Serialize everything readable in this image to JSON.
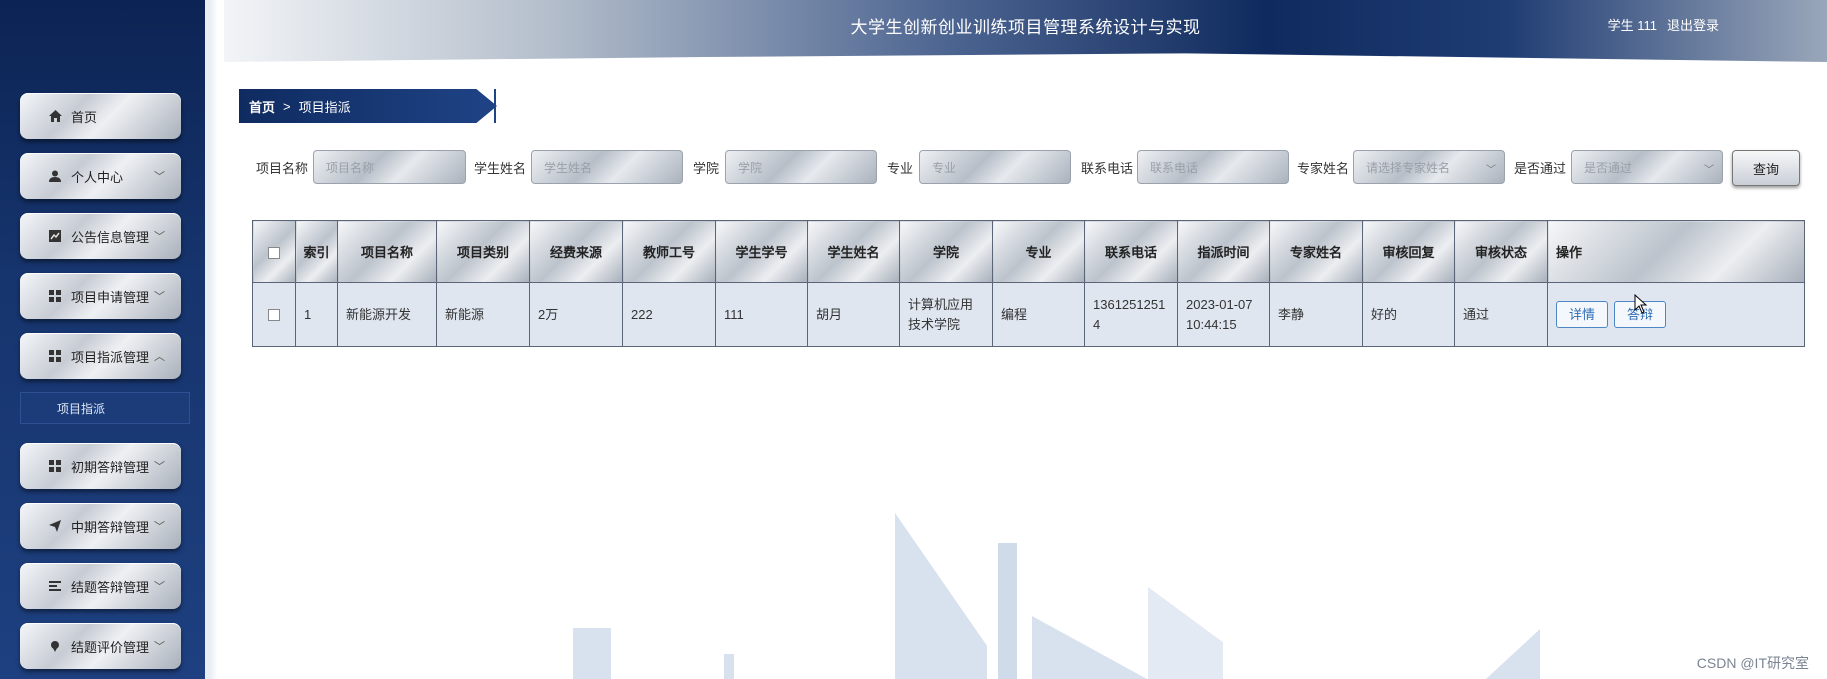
{
  "header": {
    "title": "大学生创新创业训练项目管理系统设计与实现",
    "user": "学生 111",
    "logout": "退出登录"
  },
  "sidebar": {
    "items": [
      {
        "label": "首页",
        "icon": "home-icon",
        "chevron": ""
      },
      {
        "label": "个人中心",
        "icon": "user-icon",
        "chevron": "﹀"
      },
      {
        "label": "公告信息管理",
        "icon": "chart-icon",
        "chevron": "﹀"
      },
      {
        "label": "项目申请管理",
        "icon": "grid-icon",
        "chevron": "﹀"
      },
      {
        "label": "项目指派管理",
        "icon": "grid-icon",
        "chevron": "︿"
      },
      {
        "label": "初期答辩管理",
        "icon": "grid-icon",
        "chevron": "﹀"
      },
      {
        "label": "中期答辩管理",
        "icon": "send-icon",
        "chevron": "﹀"
      },
      {
        "label": "结题答辩管理",
        "icon": "list-icon",
        "chevron": "﹀"
      },
      {
        "label": "结题评价管理",
        "icon": "pin-icon",
        "chevron": "﹀"
      }
    ],
    "submenu_active": "项目指派"
  },
  "breadcrumb": {
    "home": "首页",
    "separator": ">",
    "current": "项目指派"
  },
  "search": {
    "fields": [
      {
        "label": "项目名称",
        "placeholder": "项目名称",
        "dropdown": false
      },
      {
        "label": "学生姓名",
        "placeholder": "学生姓名",
        "dropdown": false
      },
      {
        "label": "学院",
        "placeholder": "学院",
        "dropdown": false
      },
      {
        "label": "专业",
        "placeholder": "专业",
        "dropdown": false
      },
      {
        "label": "联系电话",
        "placeholder": "联系电话",
        "dropdown": false
      },
      {
        "label": "专家姓名",
        "placeholder": "请选择专家姓名",
        "dropdown": true
      },
      {
        "label": "是否通过",
        "placeholder": "是否通过",
        "dropdown": true
      }
    ],
    "button": "查询"
  },
  "table": {
    "columns": [
      "",
      "索引",
      "项目名称",
      "项目类别",
      "经费来源",
      "教师工号",
      "学生学号",
      "学生姓名",
      "学院",
      "专业",
      "联系电话",
      "指派时间",
      "专家姓名",
      "审核回复",
      "审核状态",
      "操作"
    ],
    "rows": [
      {
        "index": "1",
        "project_name": "新能源开发",
        "project_type": "新能源",
        "funding": "2万",
        "teacher_id": "222",
        "student_id": "111",
        "student_name": "胡月",
        "college": "计算机应用技术学院",
        "major": "编程",
        "phone": "13612512514",
        "assign_time": "2023-01-07 10:44:15",
        "expert": "李静",
        "reply": "好的",
        "status": "通过",
        "actions": [
          "详情",
          "答辩"
        ]
      }
    ]
  },
  "watermark": "CSDN @IT研究室"
}
